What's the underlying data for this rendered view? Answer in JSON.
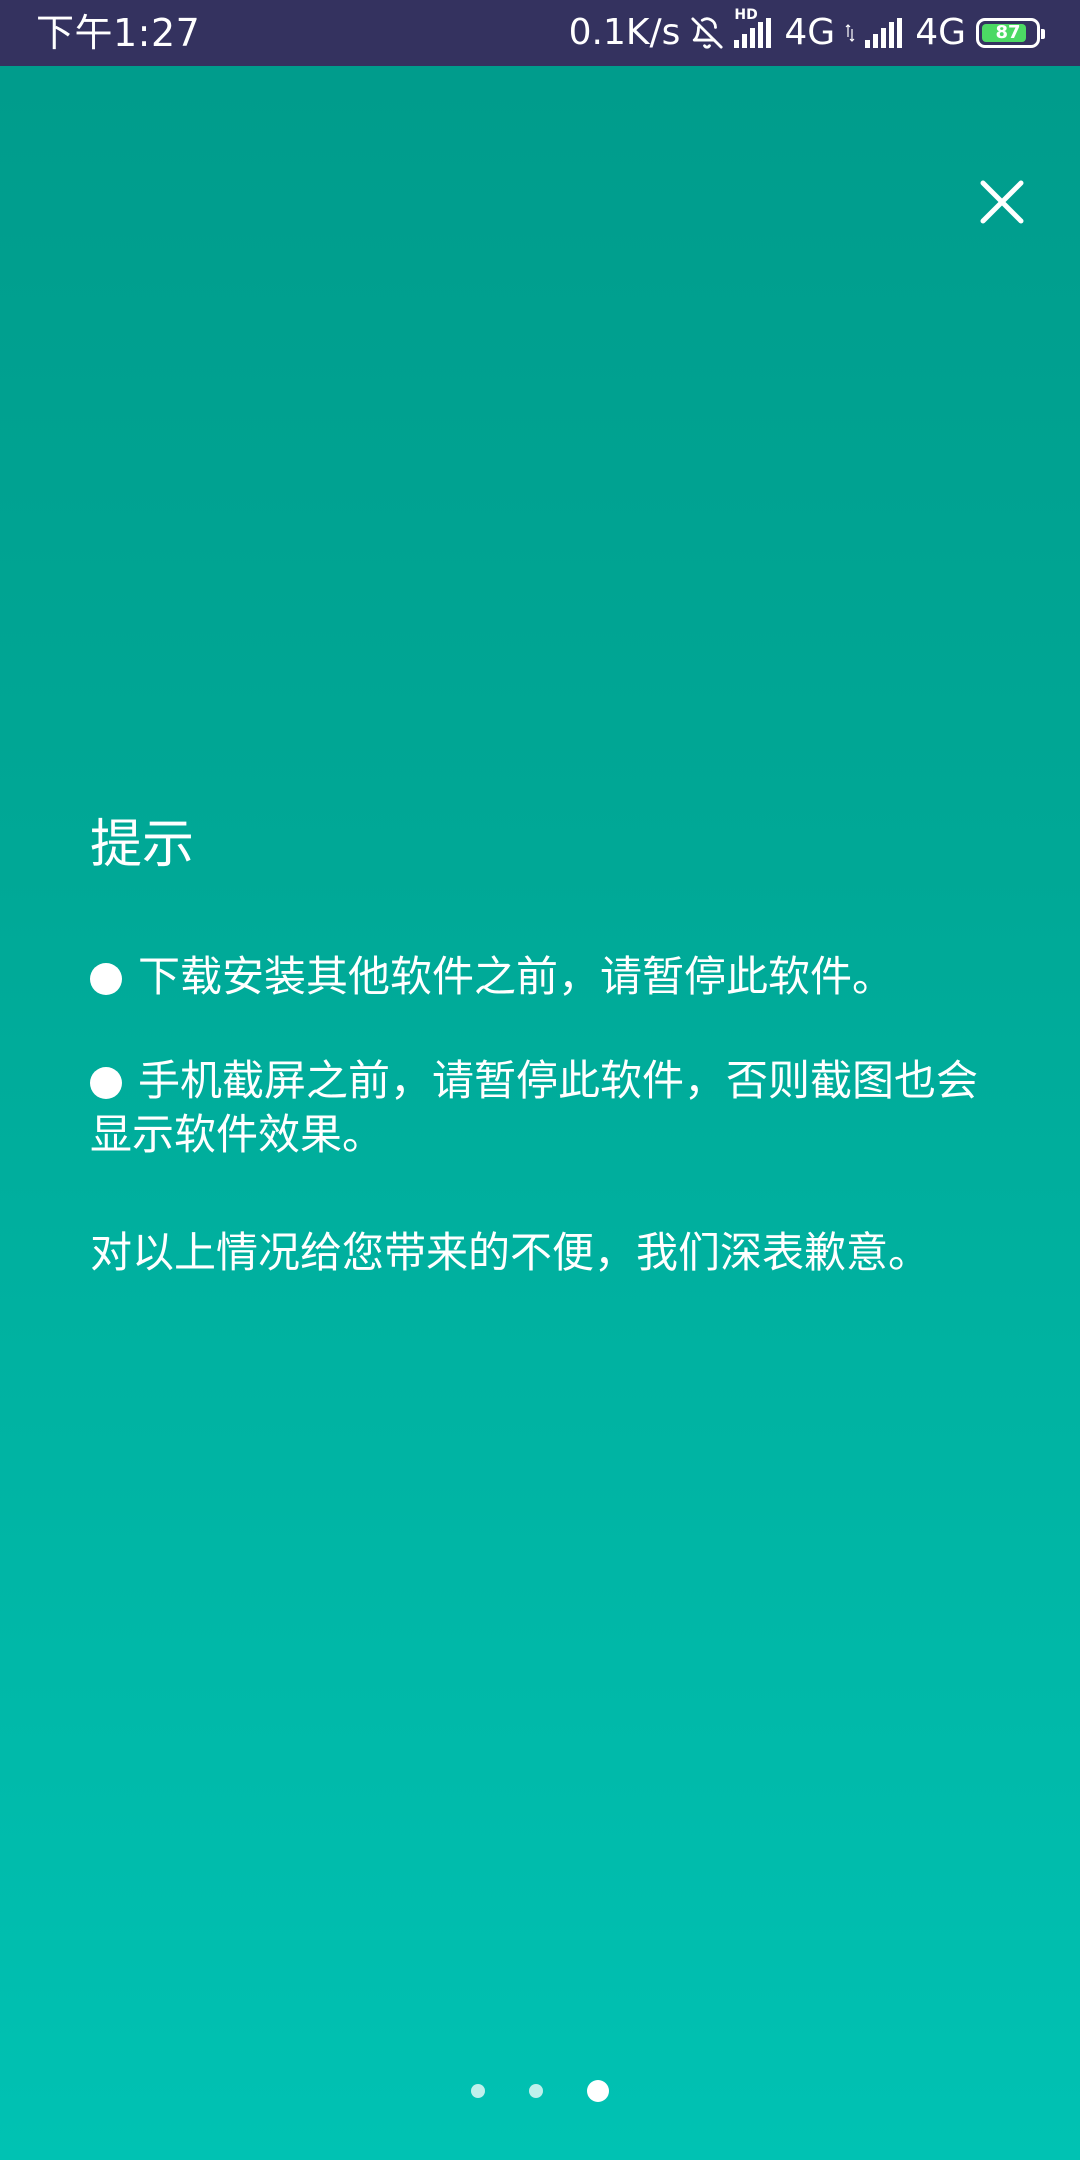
{
  "status_bar": {
    "time": "下午1:27",
    "net_speed": "0.1K/s",
    "network1": "4G",
    "network2": "4G",
    "hd_label": "HD",
    "battery_level": "87",
    "battery_fraction": 0.87,
    "icons": [
      "bell-off-icon",
      "signal-icon",
      "signal-icon",
      "battery-icon"
    ]
  },
  "close_icon": "close-icon",
  "tip": {
    "title": "提示",
    "items": [
      "下载安装其他软件之前，请暂停此软件。",
      "手机截屏之前，请暂停此软件，否则截图也会显示软件效果。"
    ],
    "apology": "对以上情况给您带来的不便，我们深表歉意。"
  },
  "pager": {
    "count": 3,
    "active_index": 2
  },
  "colors": {
    "status_bar_bg": "#34325F",
    "gradient_top": "#009B8B",
    "gradient_bottom": "#00C2B3",
    "battery_fill": "#4CD964",
    "text": "#FFFFFF"
  }
}
